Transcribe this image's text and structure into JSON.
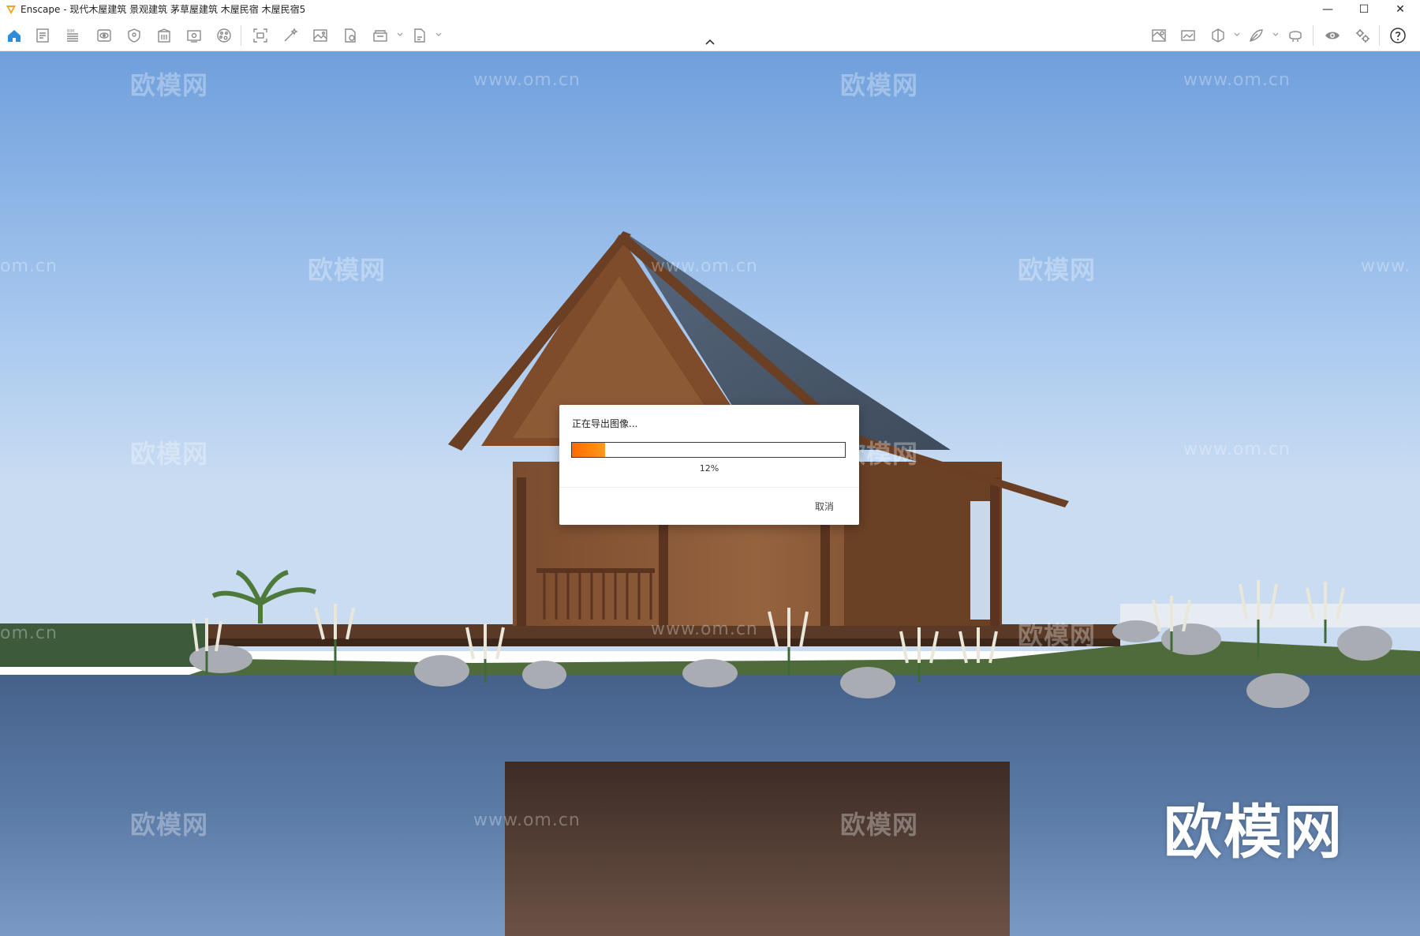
{
  "window": {
    "title": "Enscape - 现代木屋建筑 景观建筑 茅草屋建筑 木屋民宿 木屋民宿5",
    "controls": {
      "minimize": "—",
      "maximize": "☐",
      "close": "✕"
    }
  },
  "toolbar": {
    "left_icons": [
      "home-icon",
      "document-icon",
      "bim-icon",
      "eye-view-icon",
      "shield-icon",
      "building-icon",
      "monitor-icon",
      "palette-icon",
      "screenshot-icon",
      "magic-wand-icon",
      "image-icon",
      "export-file-icon",
      "batch-render-icon",
      "export-document-icon"
    ],
    "right_icons": [
      "map-photo-icon",
      "landscape-icon",
      "cube-icon",
      "feather-icon",
      "vr-headset-icon",
      "visibility-icon",
      "settings-icon",
      "help-icon"
    ],
    "accent_color": "#2e8ddb"
  },
  "viewport": {
    "watermark_text": "欧模网",
    "watermark_url": "www.om.cn",
    "watermark_url_partial": "om.cn",
    "watermark_url_partial_right": "www.",
    "brand_logo": "欧模网"
  },
  "dialog": {
    "message": "正在导出图像...",
    "progress_percent": 12,
    "progress_label": "12%",
    "cancel_label": "取消",
    "progress_color": "#ff7a00"
  }
}
